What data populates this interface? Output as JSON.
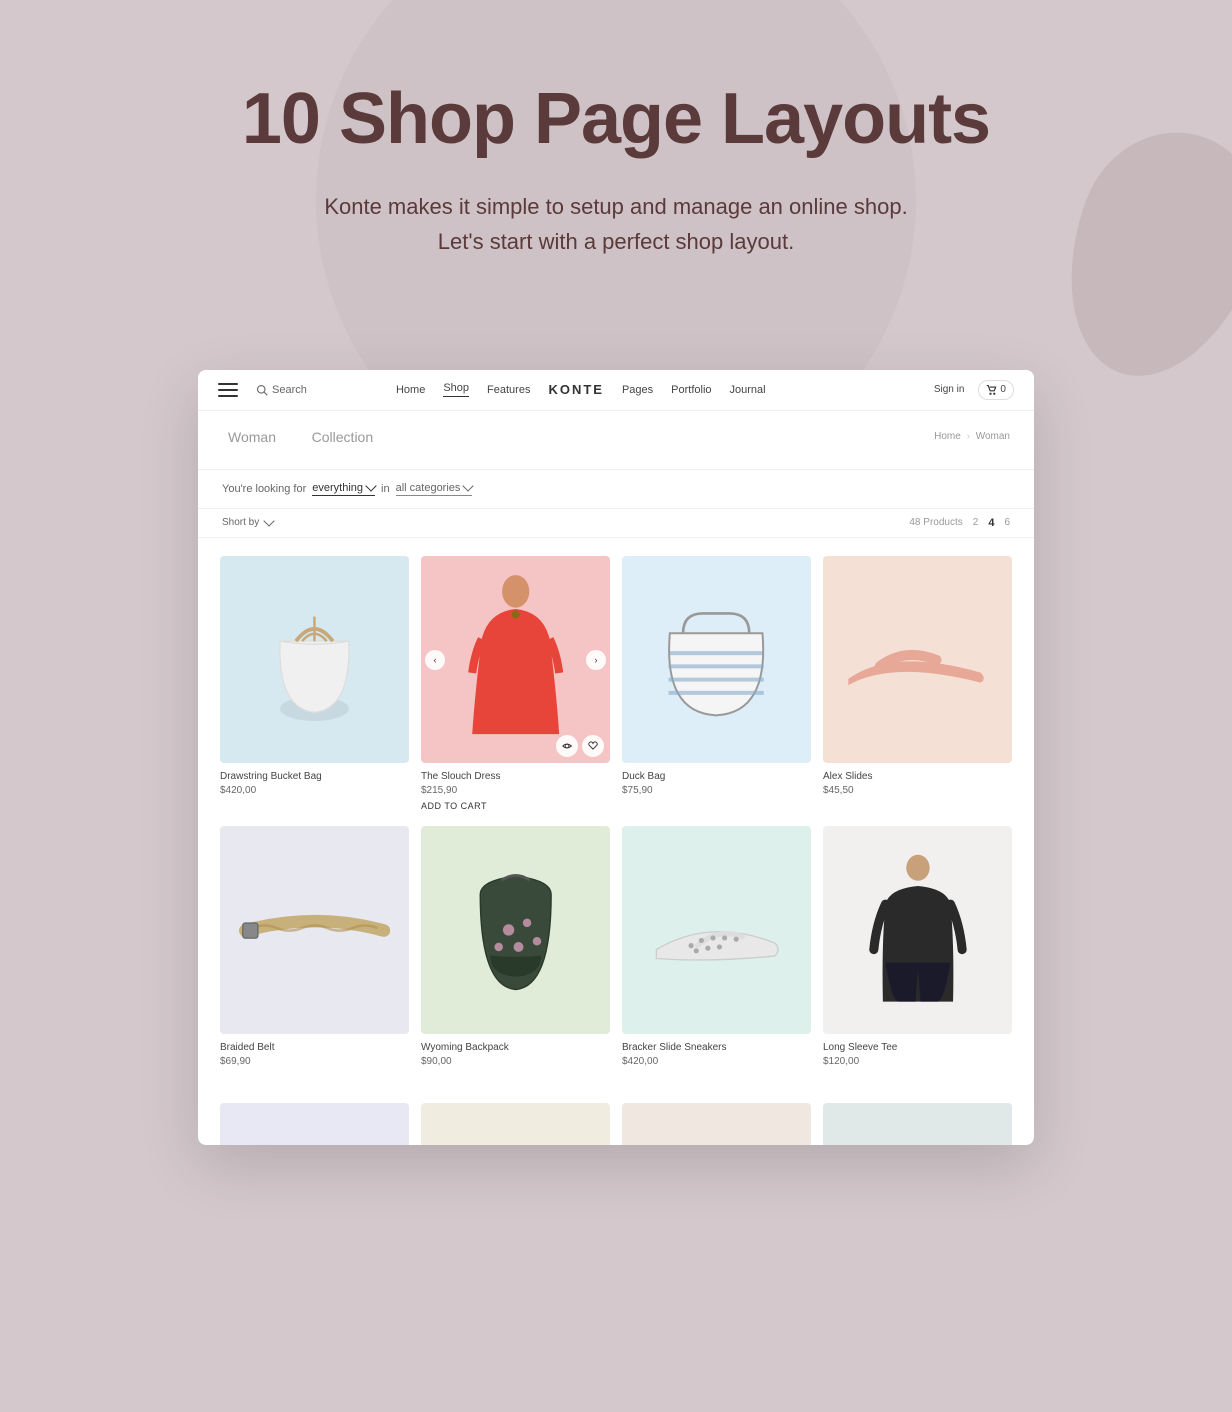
{
  "hero": {
    "title": "10 Shop Page Layouts",
    "subtitle_line1": "Konte makes it simple to setup and manage an online shop.",
    "subtitle_line2": "Let's start with a perfect shop layout."
  },
  "navbar": {
    "hamburger_label": "menu",
    "search_label": "Search",
    "links": [
      {
        "label": "Home",
        "active": false
      },
      {
        "label": "Shop",
        "active": true
      },
      {
        "label": "Features",
        "active": false
      },
      {
        "label": "Pages",
        "active": false
      },
      {
        "label": "Portfolio",
        "active": false
      },
      {
        "label": "Journal",
        "active": false
      }
    ],
    "logo": "KONTE",
    "sign_in": "Sign in",
    "cart_count": "0",
    "cart_label": "0"
  },
  "shop_header": {
    "breadcrumb_home": "Home",
    "breadcrumb_current": "Woman",
    "collection_title": "Woman",
    "collection_subtitle": "Collection"
  },
  "filter": {
    "looking_for_text": "You're looking for",
    "everything_label": "everything",
    "in_text": "in",
    "all_categories_label": "all categories"
  },
  "sort": {
    "sort_by_label": "Short by",
    "products_count": "48 Products",
    "grid_options": [
      "2",
      "4",
      "6"
    ],
    "active_grid": "4"
  },
  "products": [
    {
      "name": "Drawstring Bucket Bag",
      "price": "$420,00",
      "bg_class": "bg-blue",
      "has_carousel": false,
      "has_actions": false,
      "add_to_cart": false
    },
    {
      "name": "The Slouch Dress",
      "price": "$215,90",
      "bg_class": "bg-pink",
      "has_carousel": true,
      "has_actions": true,
      "add_to_cart": true,
      "add_to_cart_label": "ADD TO CART"
    },
    {
      "name": "Duck Bag",
      "price": "$75,90",
      "bg_class": "bg-light-blue",
      "has_carousel": false,
      "has_actions": false,
      "add_to_cart": false
    },
    {
      "name": "Alex Slides",
      "price": "$45,50",
      "bg_class": "bg-peach",
      "has_carousel": false,
      "has_actions": false,
      "add_to_cart": false
    },
    {
      "name": "Braided Belt",
      "price": "$69,90",
      "bg_class": "bg-light-gray",
      "has_carousel": false,
      "has_actions": false,
      "add_to_cart": false
    },
    {
      "name": "Wyoming Backpack",
      "price": "$90,00",
      "bg_class": "bg-light-green",
      "has_carousel": false,
      "has_actions": false,
      "add_to_cart": false
    },
    {
      "name": "Bracker Slide Sneakers",
      "price": "$420,00",
      "bg_class": "bg-light-mint",
      "has_carousel": false,
      "has_actions": false,
      "add_to_cart": false
    },
    {
      "name": "Long Sleeve Tee",
      "price": "$120,00",
      "bg_class": "bg-warm-white",
      "has_carousel": false,
      "has_actions": false,
      "add_to_cart": false
    }
  ],
  "colors": {
    "hero_bg": "#d4c8cc",
    "hero_title": "#5a3a3a",
    "accent": "#5a3a3a"
  }
}
